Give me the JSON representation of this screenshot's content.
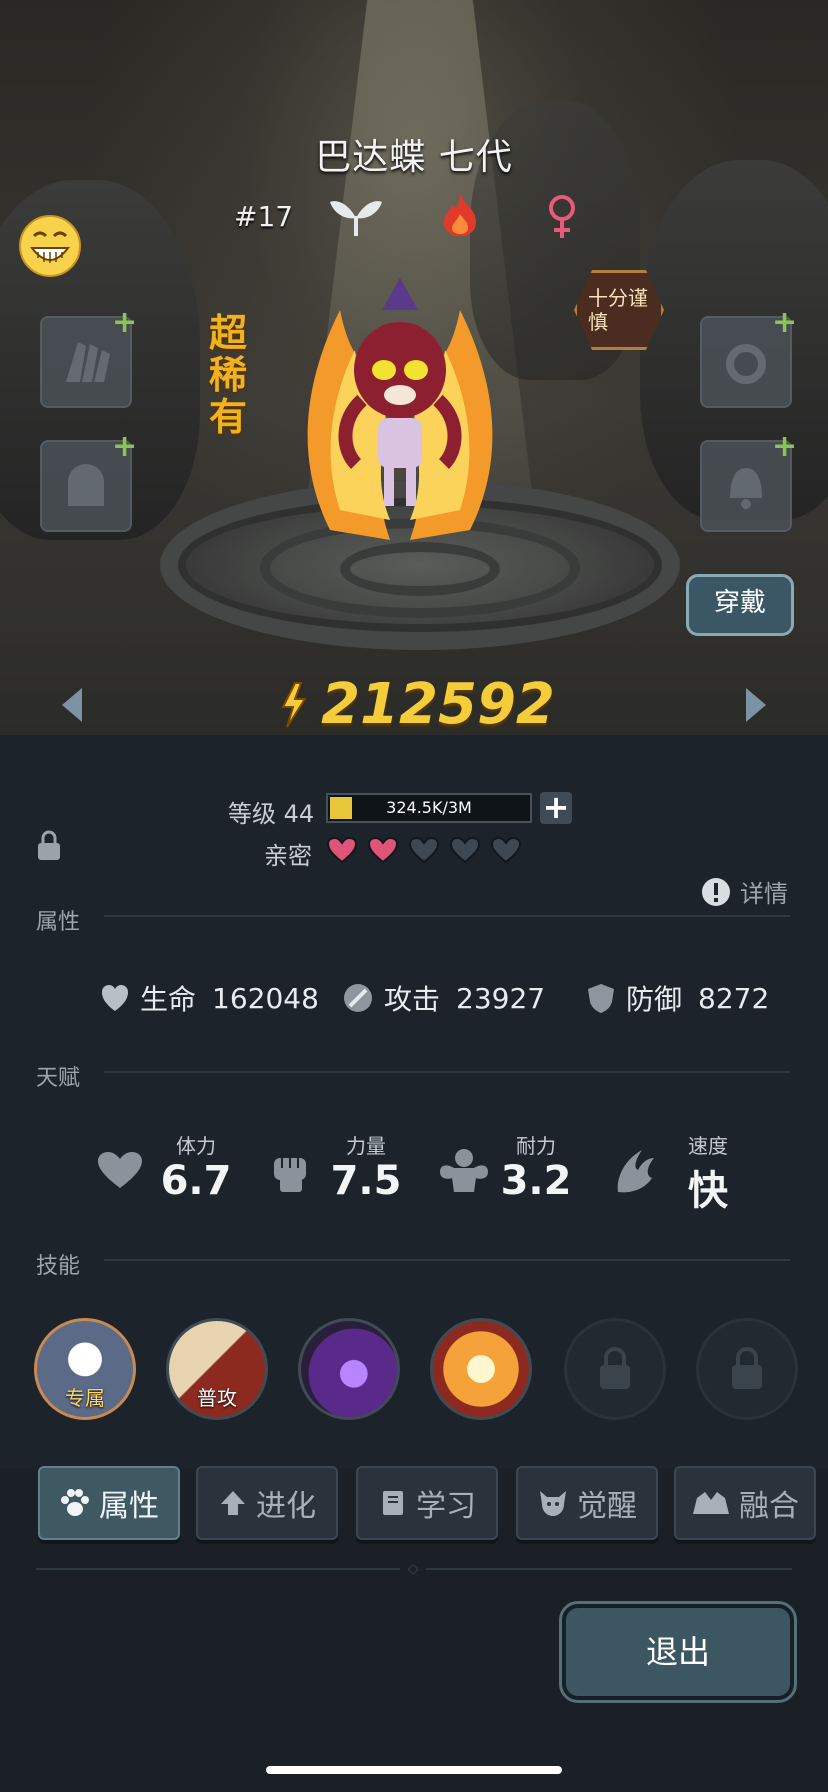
{
  "character": {
    "name": "巴达蝶 七代",
    "number": "#17",
    "rarity": "超稀有",
    "personality_badge": "十分谨慎",
    "power": "212592",
    "wear_label": "穿戴"
  },
  "level": {
    "label": "等级 44",
    "xp_text": "324.5K/3M",
    "xp_fraction": 0.11,
    "intimacy_label": "亲密",
    "hearts_filled": 2,
    "hearts_total": 5,
    "details_label": "详情"
  },
  "sections": {
    "attributes": "属性",
    "talent": "天赋",
    "skills": "技能"
  },
  "stats": [
    {
      "label": "生命",
      "value": "162048",
      "icon": "heart-shield-icon"
    },
    {
      "label": "攻击",
      "value": "23927",
      "icon": "sword-icon"
    },
    {
      "label": "防御",
      "value": "8272",
      "icon": "shield-icon"
    }
  ],
  "talents": [
    {
      "label": "体力",
      "value": "6.7",
      "icon": "heart-icon"
    },
    {
      "label": "力量",
      "value": "7.5",
      "icon": "fist-icon"
    },
    {
      "label": "耐力",
      "value": "3.2",
      "icon": "muscle-icon"
    },
    {
      "label": "速度",
      "value": "快",
      "icon": "wing-icon"
    }
  ],
  "skills": [
    {
      "label": "专属"
    },
    {
      "label": "普攻"
    },
    {
      "label": ""
    },
    {
      "label": ""
    }
  ],
  "tabs": [
    {
      "label": "属性",
      "icon": "paw-icon",
      "active": true
    },
    {
      "label": "进化",
      "icon": "up-arrow-icon",
      "active": false
    },
    {
      "label": "学习",
      "icon": "book-icon",
      "active": false
    },
    {
      "label": "觉醒",
      "icon": "beast-head-icon",
      "active": false
    },
    {
      "label": "融合",
      "icon": "merge-icon",
      "active": false
    }
  ],
  "exit_label": "退出",
  "colors": {
    "accent": "#f5cc3a",
    "panel": "#1c232a",
    "heart_filled": "#e0547a",
    "heart_empty": "#3e4852"
  }
}
